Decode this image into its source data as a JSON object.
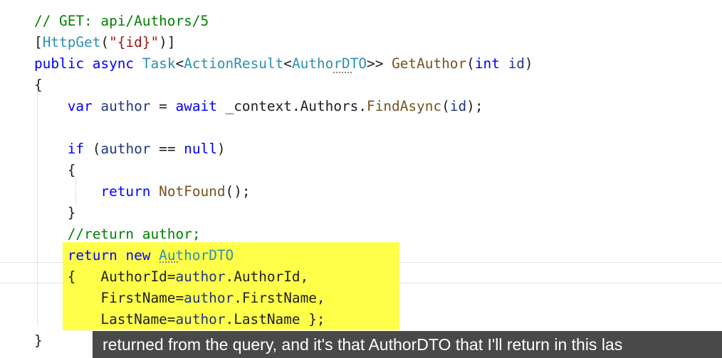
{
  "colors": {
    "comment": "#008000",
    "keyword": "#0000ff",
    "type": "#2b91af",
    "method": "#74531f",
    "string": "#a31515",
    "variable": "#1f377f",
    "plain": "#1e1e1e",
    "highlight": "#ffff4a",
    "caption_bg": "#3a3a3a"
  },
  "code": {
    "lines": [
      [
        {
          "t": "// GET: api/Authors/5",
          "k": "comment"
        }
      ],
      [
        {
          "t": "[",
          "k": "plain"
        },
        {
          "t": "HttpGet",
          "k": "type"
        },
        {
          "t": "(",
          "k": "plain"
        },
        {
          "t": "\"{id}\"",
          "k": "string"
        },
        {
          "t": ")]",
          "k": "plain"
        }
      ],
      [
        {
          "t": "public",
          "k": "keyword"
        },
        {
          "t": " ",
          "k": "plain"
        },
        {
          "t": "async",
          "k": "keyword"
        },
        {
          "t": " ",
          "k": "plain"
        },
        {
          "t": "Task",
          "k": "type"
        },
        {
          "t": "<",
          "k": "plain"
        },
        {
          "t": "ActionResult",
          "k": "type"
        },
        {
          "t": "<",
          "k": "plain"
        },
        {
          "t": "AuthorDTO",
          "k": "type"
        },
        {
          "t": ">> ",
          "k": "plain"
        },
        {
          "t": "GetAuthor",
          "k": "method"
        },
        {
          "t": "(",
          "k": "plain"
        },
        {
          "t": "int",
          "k": "keyword"
        },
        {
          "t": " ",
          "k": "plain"
        },
        {
          "t": "id",
          "k": "variable"
        },
        {
          "t": ")",
          "k": "plain"
        }
      ],
      [
        {
          "t": "{",
          "k": "plain"
        }
      ],
      [
        {
          "t": "    ",
          "k": "plain"
        },
        {
          "t": "var",
          "k": "keyword"
        },
        {
          "t": " ",
          "k": "plain"
        },
        {
          "t": "author",
          "k": "variable"
        },
        {
          "t": " = ",
          "k": "plain"
        },
        {
          "t": "await",
          "k": "keyword"
        },
        {
          "t": " _context.Authors.",
          "k": "plain"
        },
        {
          "t": "FindAsync",
          "k": "method"
        },
        {
          "t": "(",
          "k": "plain"
        },
        {
          "t": "id",
          "k": "variable"
        },
        {
          "t": ");",
          "k": "plain"
        }
      ],
      [],
      [
        {
          "t": "    ",
          "k": "plain"
        },
        {
          "t": "if",
          "k": "keyword"
        },
        {
          "t": " (",
          "k": "plain"
        },
        {
          "t": "author",
          "k": "variable"
        },
        {
          "t": " == ",
          "k": "plain"
        },
        {
          "t": "null",
          "k": "keyword"
        },
        {
          "t": ")",
          "k": "plain"
        }
      ],
      [
        {
          "t": "    {",
          "k": "plain"
        }
      ],
      [
        {
          "t": "        ",
          "k": "plain"
        },
        {
          "t": "return",
          "k": "keyword"
        },
        {
          "t": " ",
          "k": "plain"
        },
        {
          "t": "NotFound",
          "k": "method"
        },
        {
          "t": "();",
          "k": "plain"
        }
      ],
      [
        {
          "t": "    }",
          "k": "plain"
        }
      ],
      [
        {
          "t": "    ",
          "k": "plain"
        },
        {
          "t": "//return author;",
          "k": "comment"
        }
      ],
      [
        {
          "t": "    ",
          "k": "plain"
        },
        {
          "t": "return",
          "k": "keyword"
        },
        {
          "t": " ",
          "k": "plain"
        },
        {
          "t": "new",
          "k": "keyword"
        },
        {
          "t": " ",
          "k": "plain"
        },
        {
          "t": "AuthorDTO",
          "k": "type"
        }
      ],
      [
        {
          "t": "    {   AuthorId=",
          "k": "plain"
        },
        {
          "t": "author",
          "k": "variable"
        },
        {
          "t": ".AuthorId,",
          "k": "plain"
        }
      ],
      [
        {
          "t": "        FirstName=",
          "k": "plain"
        },
        {
          "t": "author",
          "k": "variable"
        },
        {
          "t": ".FirstName,",
          "k": "plain"
        }
      ],
      [
        {
          "t": "        LastName=",
          "k": "plain"
        },
        {
          "t": "author",
          "k": "variable"
        },
        {
          "t": ".LastName };",
          "k": "plain"
        }
      ],
      [
        {
          "t": "}",
          "k": "plain"
        }
      ]
    ]
  },
  "caption": {
    "text": "returned from the query, and it's that AuthorDTO that I'll return in this las"
  }
}
